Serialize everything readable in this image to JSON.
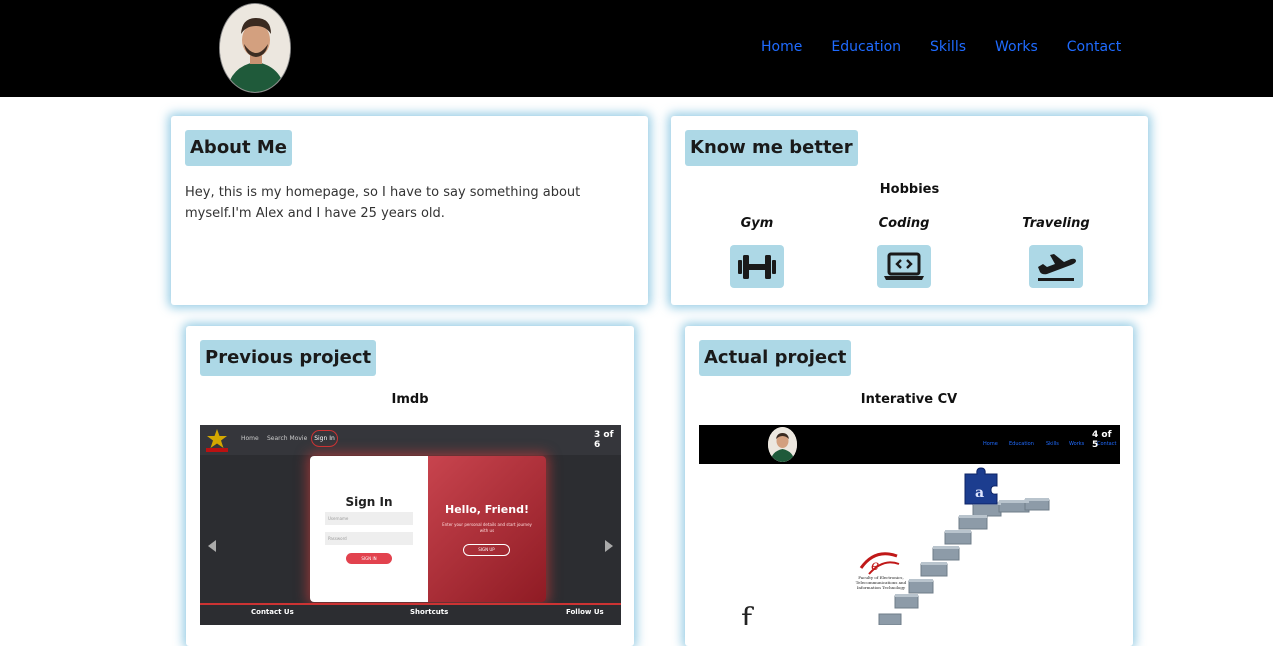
{
  "nav": {
    "items": [
      "Home",
      "Education",
      "Skills",
      "Works",
      "Contact"
    ]
  },
  "about": {
    "title": "About Me",
    "text": "Hey, this is my homepage, so I have to say something about myself.I'm Alex and I have 25 years old."
  },
  "know": {
    "title": "Know me better",
    "hobbies_heading": "Hobbies",
    "hobbies": [
      {
        "label": "Gym",
        "icon": "dumbbell-icon"
      },
      {
        "label": "Coding",
        "icon": "laptop-code-icon"
      },
      {
        "label": "Traveling",
        "icon": "plane-icon"
      }
    ]
  },
  "previous": {
    "title": "Previous project",
    "name": "Imdb",
    "counter": "3 of 6",
    "screenshot": {
      "nav": [
        "Home",
        "Search Movie",
        "Sign In"
      ],
      "sign_in_heading": "Sign In",
      "username_placeholder": "Username",
      "password_placeholder": "Password",
      "sign_in_button": "SIGN IN",
      "hello_heading": "Hello, Friend!",
      "hello_text": "Enter your personal details and start journey with us",
      "sign_up_button": "SIGN UP",
      "footer": [
        "Contact Us",
        "Shortcuts",
        "Follow Us"
      ]
    }
  },
  "actual": {
    "title": "Actual project",
    "name": "Interative CV",
    "counter": "4 of 5",
    "screenshot": {
      "nav": [
        "Home",
        "Education",
        "Skills",
        "Works",
        "Contact"
      ],
      "faculty_text": "Faculty of Electronics, Telecommunications and Information Technology"
    }
  },
  "colors": {
    "accent": "#add8e6",
    "nav_link": "#1f6bff",
    "header_bg": "#000000"
  }
}
